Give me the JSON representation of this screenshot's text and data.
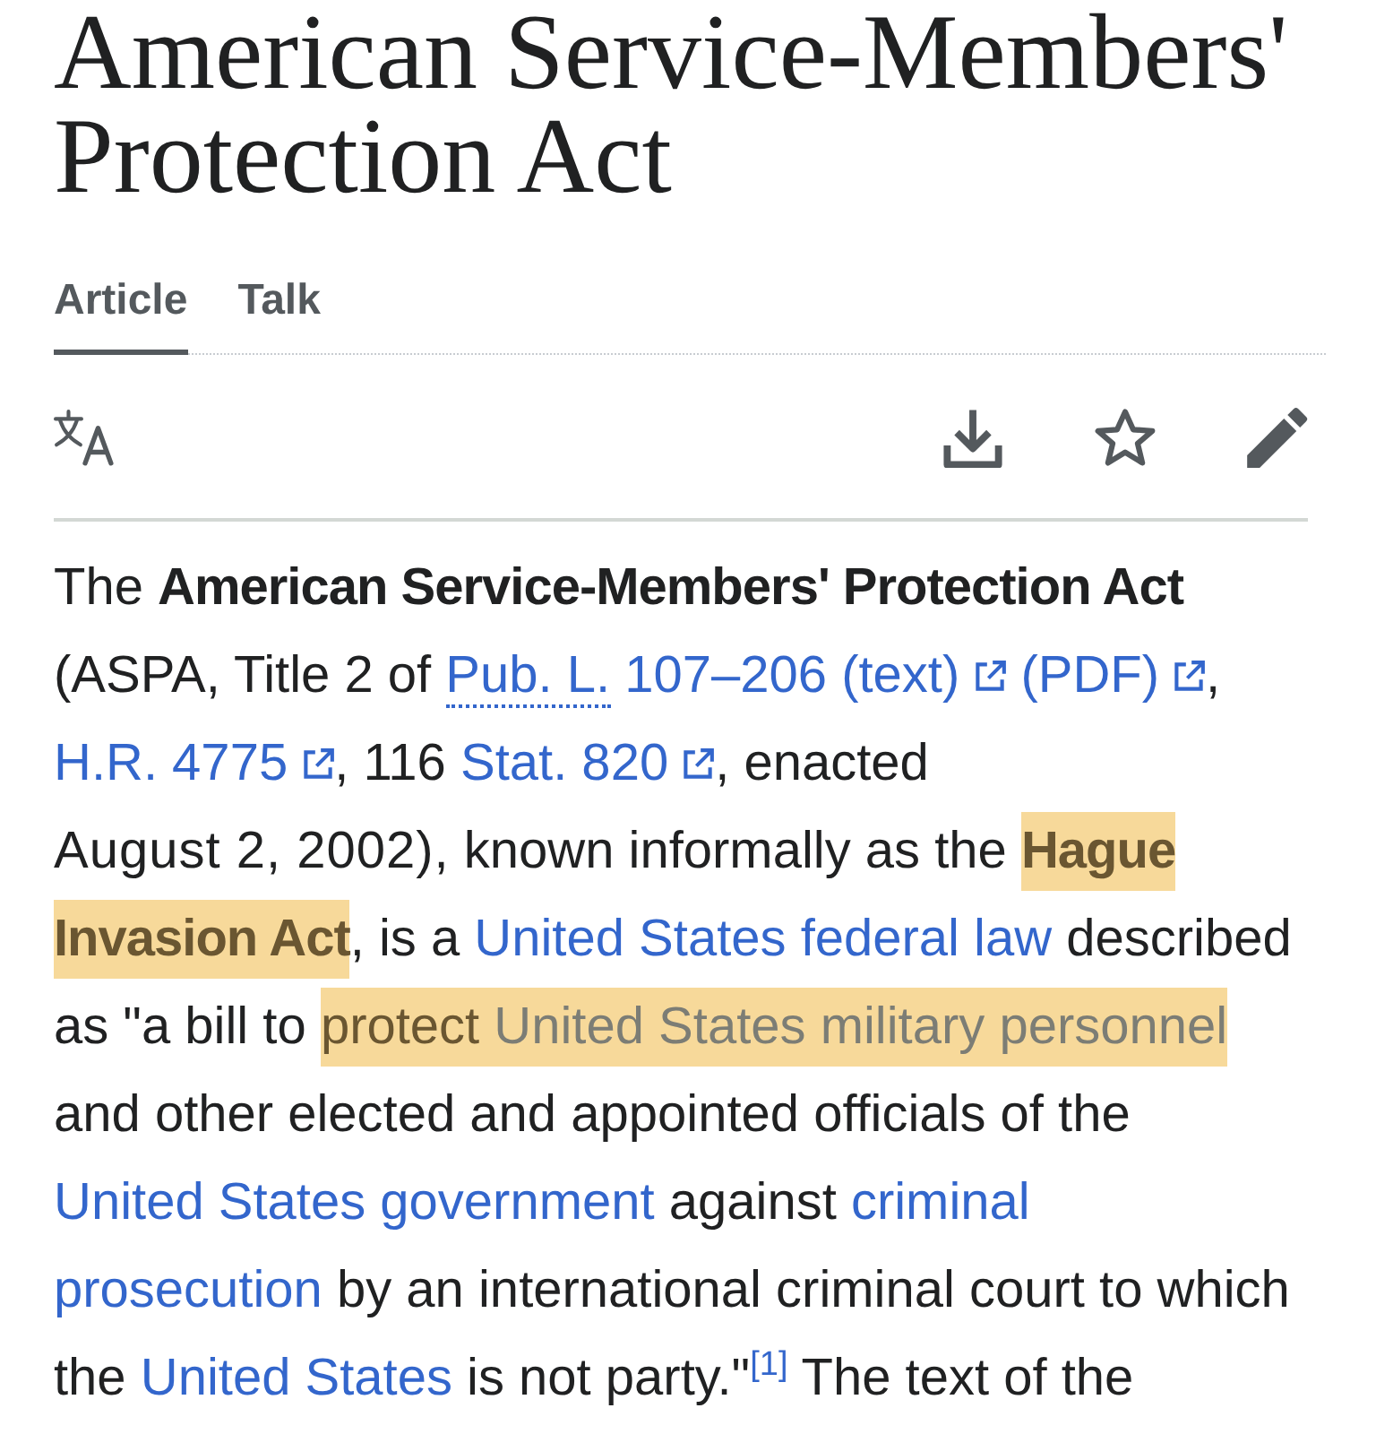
{
  "title": "American Service-Members' Protection Act",
  "tabs": [
    {
      "label": "Article",
      "selected": true
    },
    {
      "label": "Talk",
      "selected": false
    }
  ],
  "page_actions": {
    "watched": false
  },
  "paragraph": [
    {
      "kind": "text",
      "text": "The ",
      "highlighted": false
    },
    {
      "kind": "bold",
      "text": "American Service-Members' Protection Act",
      "highlighted": false
    },
    {
      "kind": "text",
      "text": " (ASPA, Title 2 of ",
      "highlighted": false
    },
    {
      "kind": "external_link",
      "abbr": "Pub. L.",
      "text": " 107–206 (text)",
      "highlighted": false
    },
    {
      "kind": "external_link",
      "text": "(PDF)",
      "highlighted": false
    },
    {
      "kind": "text",
      "text": ", ",
      "highlighted": false
    },
    {
      "kind": "external_link",
      "text": "H.R. 4775",
      "highlighted": false
    },
    {
      "kind": "text",
      "text": ", 116 ",
      "highlighted": false
    },
    {
      "kind": "external_link",
      "text": "Stat. 820",
      "highlighted": false
    },
    {
      "kind": "text",
      "text": ", enacted ",
      "highlighted": false
    },
    {
      "kind": "date",
      "text": "August 2, 2002),",
      "highlighted": false
    },
    {
      "kind": "text",
      "text": " known informally as the ",
      "highlighted": false
    },
    {
      "kind": "bold",
      "text": "Hague",
      "highlighted": true
    },
    {
      "kind": "bold",
      "text": "Invasion Act",
      "highlighted": true
    },
    {
      "kind": "text",
      "text": ", is a ",
      "highlighted": false
    },
    {
      "kind": "link",
      "text": "United States federal law",
      "highlighted": false
    },
    {
      "kind": "text",
      "text": " described as \"a bill to ",
      "highlighted": false
    },
    {
      "kind": "text",
      "text": "protect ",
      "highlighted": true
    },
    {
      "kind": "link",
      "text": "United States military personnel",
      "highlighted": true
    },
    {
      "kind": "text",
      "text": " and other elected and appointed officials of the ",
      "highlighted": false
    },
    {
      "kind": "link",
      "text": "United States government",
      "highlighted": false
    },
    {
      "kind": "text",
      "text": " against ",
      "highlighted": false
    },
    {
      "kind": "link",
      "text": "criminal",
      "highlighted": false
    },
    {
      "kind": "link",
      "text": "prosecution",
      "highlighted": false
    },
    {
      "kind": "text",
      "text": " by an international criminal court to which the ",
      "highlighted": false
    },
    {
      "kind": "link",
      "text": "United States",
      "highlighted": false
    },
    {
      "kind": "text",
      "text": " is not party.\"",
      "highlighted": false
    },
    {
      "kind": "ref",
      "text": "[1]",
      "highlighted": false
    },
    {
      "kind": "text",
      "text": " The text of the",
      "highlighted": false
    }
  ]
}
